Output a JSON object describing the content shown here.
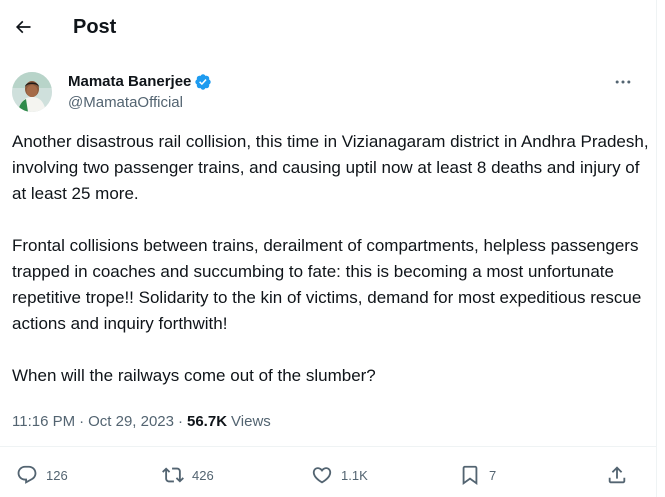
{
  "header": {
    "title": "Post"
  },
  "author": {
    "name": "Mamata Banerjee",
    "handle": "@MamataOfficial"
  },
  "tweet": {
    "paragraphs": [
      "Another disastrous rail collision, this time in Vizianagaram district in Andhra Pradesh, involving two passenger trains, and causing uptil now at least 8 deaths and injury of at least 25 more.",
      "Frontal collisions between trains, derailment of compartments, helpless passengers trapped in coaches and succumbing to fate: this is becoming a most unfortunate repetitive trope!! Solidarity to the kin of victims, demand for most expeditious rescue actions and inquiry forthwith!",
      "When will the railways come out of the slumber?"
    ]
  },
  "meta": {
    "time": "11:16 PM",
    "separator": "·",
    "date": "Oct 29, 2023",
    "views_count": "56.7K",
    "views_label": "Views"
  },
  "actions": {
    "replies": "126",
    "reposts": "426",
    "likes": "1.1K",
    "bookmarks": "7"
  },
  "colors": {
    "text": "#0f1419",
    "secondary": "#536471",
    "verified": "#1d9bf0",
    "border": "#eff3f4"
  },
  "icons": [
    "back-arrow-icon",
    "verified-badge-icon",
    "more-icon",
    "reply-icon",
    "repost-icon",
    "like-icon",
    "bookmark-icon",
    "share-icon"
  ]
}
